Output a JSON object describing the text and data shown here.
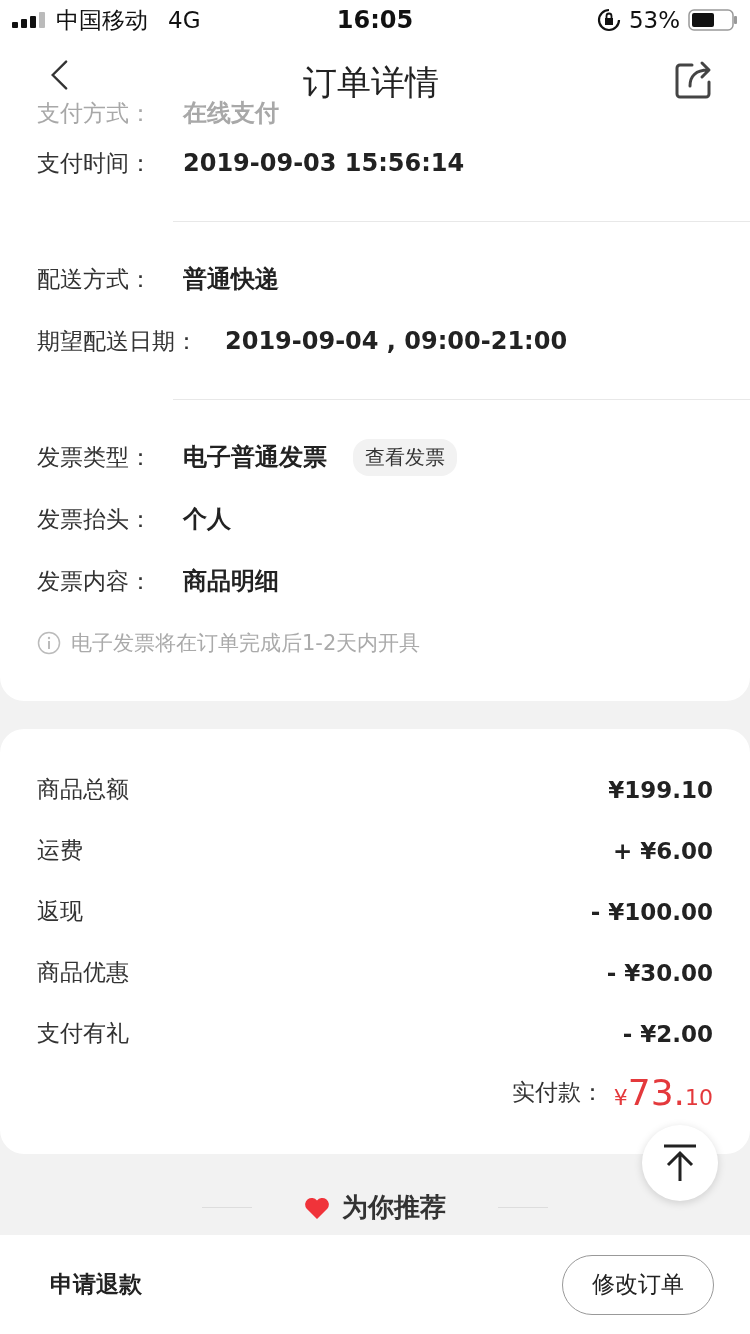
{
  "status_bar": {
    "carrier": "中国移动",
    "network": "4G",
    "time": "16:05",
    "battery": "53%"
  },
  "nav": {
    "title": "订单详情"
  },
  "faded_row": {
    "label": "支付方式：",
    "value": "在线支付"
  },
  "sections": [
    {
      "rows": [
        {
          "label": "支付时间：",
          "value": "2019-09-03 15:56:14"
        }
      ]
    },
    {
      "rows": [
        {
          "label": "配送方式：",
          "value": "普通快递"
        },
        {
          "label": "期望配送日期：",
          "value": "2019-09-04 , 09:00-21:00"
        }
      ]
    },
    {
      "rows": [
        {
          "label": "发票类型：",
          "value": "电子普通发票",
          "action": "查看发票"
        },
        {
          "label": "发票抬头：",
          "value": "个人"
        },
        {
          "label": "发票内容：",
          "value": "商品明细"
        }
      ],
      "note": "电子发票将在订单完成后1-2天内开具"
    }
  ],
  "amounts": [
    {
      "label": "商品总额",
      "value": "¥199.10"
    },
    {
      "label": "运费",
      "value": "+ ¥6.00"
    },
    {
      "label": "返现",
      "value": "- ¥100.00"
    },
    {
      "label": "商品优惠",
      "value": "- ¥30.00"
    },
    {
      "label": "支付有礼",
      "value": "- ¥2.00"
    }
  ],
  "total": {
    "label": "实付款：",
    "currency": "¥",
    "integer": "73.",
    "decimal": "10"
  },
  "recommend": {
    "title": "为你推荐"
  },
  "footer": {
    "refund": "申请退款",
    "modify": "修改订单"
  }
}
